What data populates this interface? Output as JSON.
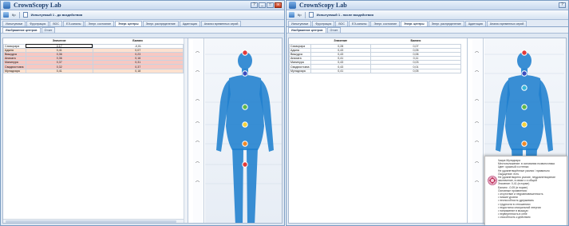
{
  "app": {
    "title": "CrownScopy Lab",
    "window_buttons": [
      "?",
      "_",
      "□",
      "x"
    ]
  },
  "toolbar": {
    "button": "Кр",
    "left_doc_title": "Испытуемый 1 - до воздействия",
    "right_doc_title": "Испытуемый 1 - после воздействия"
  },
  "tabs": {
    "main": [
      "Испытуемые",
      "Фрустрация",
      "ВОС",
      "ЕЭ-каналы",
      "Энерг. состояние",
      "Энерг. центры",
      "Энерг. распределение",
      "Адаптация",
      "Анализ временных серий"
    ],
    "active_main": "Энерг. центры",
    "sub": [
      "Изображение центров",
      "Отчет"
    ],
    "active_sub": "Изображение центров"
  },
  "table": {
    "col1": "Значение",
    "col2": "Баланс",
    "left_rows": [
      {
        "name": "Сахасрара",
        "value": "0,17",
        "balance": "-0,01"
      },
      {
        "name": "Аджна",
        "value": "0,41",
        "balance": "0,07"
      },
      {
        "name": "Вишудха",
        "value": "0,36",
        "balance": "0,23"
      },
      {
        "name": "Анахата",
        "value": "0,36",
        "balance": "0,16"
      },
      {
        "name": "Манипура",
        "value": "0,37",
        "balance": "0,31"
      },
      {
        "name": "Свадхистхана",
        "value": "0,32",
        "balance": "0,37"
      },
      {
        "name": "Муладхара",
        "value": "0,41",
        "balance": "0,18"
      }
    ],
    "right_rows": [
      {
        "name": "Сахасрара",
        "value": "0,28",
        "balance": "0,07"
      },
      {
        "name": "Аджна",
        "value": "0,43",
        "balance": "0,05"
      },
      {
        "name": "Вишудха",
        "value": "0,43",
        "balance": "0,06"
      },
      {
        "name": "Анахата",
        "value": "0,41",
        "balance": "0,11"
      },
      {
        "name": "Манипура",
        "value": "0,43",
        "balance": "0,03"
      },
      {
        "name": "Свадхистхана",
        "value": "0,43",
        "balance": "0,01"
      },
      {
        "name": "Муладхара",
        "value": "0,41",
        "balance": "0,05"
      }
    ]
  },
  "left_highlights": [
    "none",
    "peach",
    "pink",
    "pink",
    "pink",
    "pink",
    "peach"
  ],
  "left_markers": [
    "red",
    "indigo",
    "none",
    "green",
    "yellow",
    "orange",
    "red"
  ],
  "right_markers": [
    "red",
    "indigo",
    "cyan",
    "green",
    "yellow",
    "orange",
    "red"
  ],
  "colors": {
    "body_blue": "#1f7fce",
    "red": "#e23a3a",
    "orange": "#f08a2a",
    "yellow": "#f4d23a",
    "green": "#5fb84a",
    "cyan": "#36b6d8",
    "indigo": "#3a4ec0",
    "violet": "#9a3ac2",
    "pink": "#f7c8c2",
    "peach": "#fde1cf"
  },
  "popup": {
    "lines": [
      "Чакра Муладхара",
      "Местоположение: в основании позвоночника",
      "Цвет: красный и оттенки",
      "Не удовлетворённые усилия / правильно",
      "Ощущение: есть",
      "Не удовлетворено усилие, неудовлетворение",
      "заключение, в связи с и общей",
      "Значение: 0,41 (в норме)",
      "Баланс: -0,05 (в норме)",
      "Основные проявления:",
      "• отсутствие и неуравновешенность",
      "• низкие уровни",
      "• неспособность удерживать",
      "• трудности в отношениях",
      "• недостаток сексуальной энергии",
      "• напряжение в мышцах",
      "• неуверенность в себе",
      "• способность к действию"
    ]
  }
}
